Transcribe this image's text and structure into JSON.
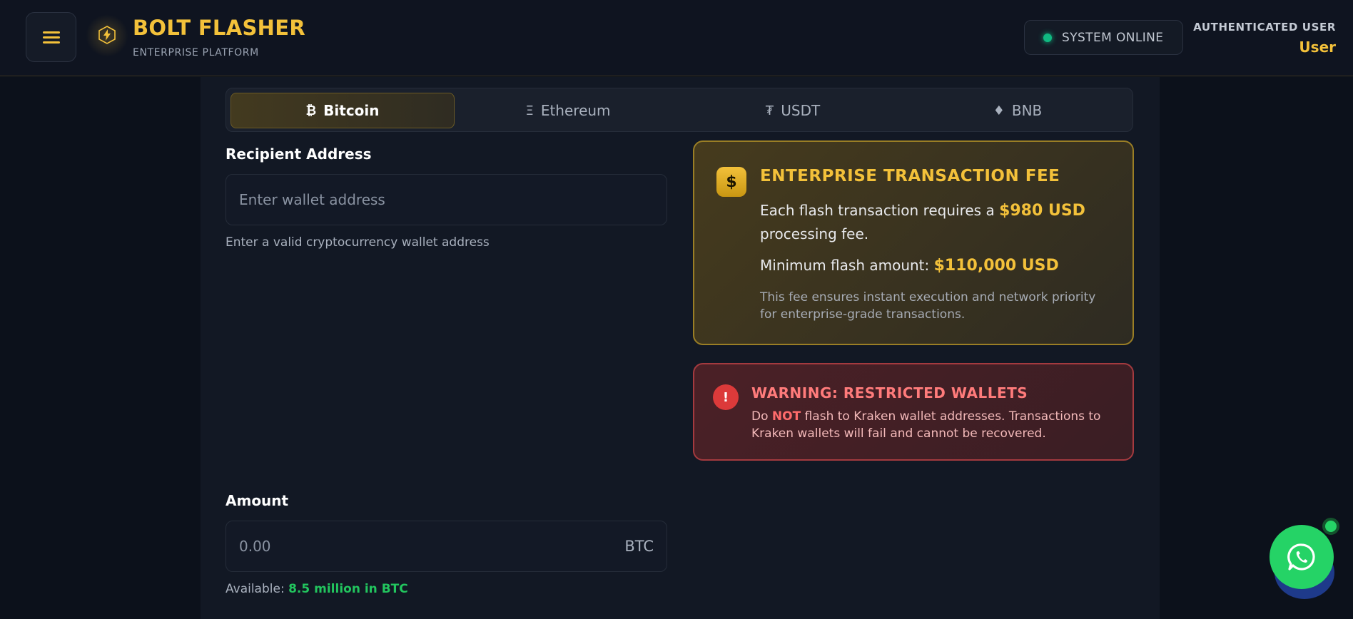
{
  "header": {
    "brand_title": "BOLT FLASHER",
    "brand_subtitle": "ENTERPRISE PLATFORM",
    "status_text": "SYSTEM ONLINE",
    "auth_label": "AUTHENTICATED USER",
    "auth_user": "User"
  },
  "tabs": [
    {
      "icon": "₿",
      "label": "Bitcoin",
      "active": true
    },
    {
      "icon": "Ξ",
      "label": "Ethereum",
      "active": false
    },
    {
      "icon": "₮",
      "label": "USDT",
      "active": false
    },
    {
      "icon": "♦",
      "label": "BNB",
      "active": false
    }
  ],
  "recipient": {
    "label": "Recipient Address",
    "placeholder": "Enter wallet address",
    "hint": "Enter a valid cryptocurrency wallet address"
  },
  "amount": {
    "label": "Amount",
    "placeholder": "0.00",
    "unit": "BTC",
    "available_label": "Available:",
    "available_value": "8.5 million in BTC"
  },
  "fee_card": {
    "icon": "$",
    "title": "ENTERPRISE TRANSACTION FEE",
    "line1_prefix": "Each flash transaction requires a",
    "fee_amount": "$980 USD",
    "line1_suffix": "processing fee.",
    "min_prefix": "Minimum flash amount:",
    "min_amount": "$110,000 USD",
    "note": "This fee ensures instant execution and network priority for enterprise-grade transactions."
  },
  "warning_card": {
    "icon": "!",
    "title": "WARNING: RESTRICTED WALLETS",
    "text_prefix": "Do",
    "text_emphasis": "NOT",
    "text_suffix": "flash to Kraken wallet addresses. Transactions to Kraken wallets will fail and cannot be recovered."
  },
  "colors": {
    "accent": "#f3c13a",
    "background": "#0c111b",
    "success": "#22c55e",
    "danger": "#dc3a3a",
    "whatsapp": "#25d366"
  }
}
